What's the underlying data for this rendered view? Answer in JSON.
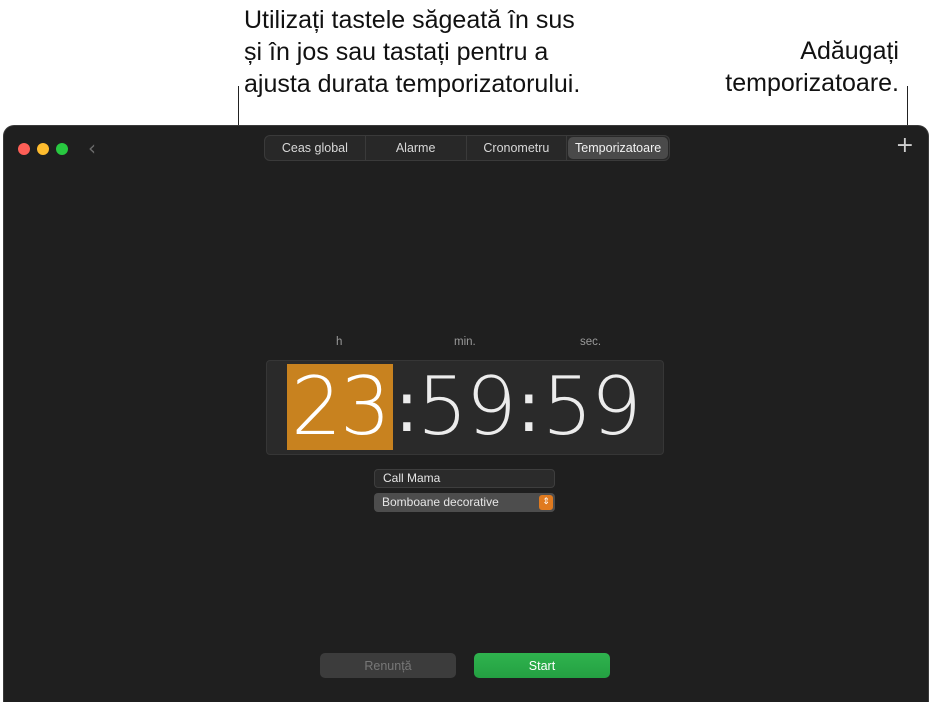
{
  "annotations": {
    "left_line1": "Utilizați tastele săgeată în sus",
    "left_line2": "și în jos sau tastați pentru a",
    "left_line3": "ajusta durata temporizatorului.",
    "right_line1": "Adăugați",
    "right_line2": "temporizatoare."
  },
  "window": {
    "back_icon": "chevron-left-icon",
    "add_icon": "plus-icon"
  },
  "tabs": [
    {
      "label": "Ceas global",
      "active": false
    },
    {
      "label": "Alarme",
      "active": false
    },
    {
      "label": "Cronometru",
      "active": false
    },
    {
      "label": "Temporizatoare",
      "active": true
    }
  ],
  "timer": {
    "unit_hours": "h",
    "unit_minutes": "min.",
    "unit_seconds": "sec.",
    "hours": "23",
    "minutes": "59",
    "seconds": "59",
    "separator": ":",
    "highlight_color": "#c8821f"
  },
  "label_field": {
    "value": "Call Mama"
  },
  "sound": {
    "selected": "Bomboane decorative"
  },
  "buttons": {
    "cancel": "Renunță",
    "start": "Start"
  },
  "colors": {
    "accent": "#e07a1f",
    "start_button": "#28a745"
  }
}
